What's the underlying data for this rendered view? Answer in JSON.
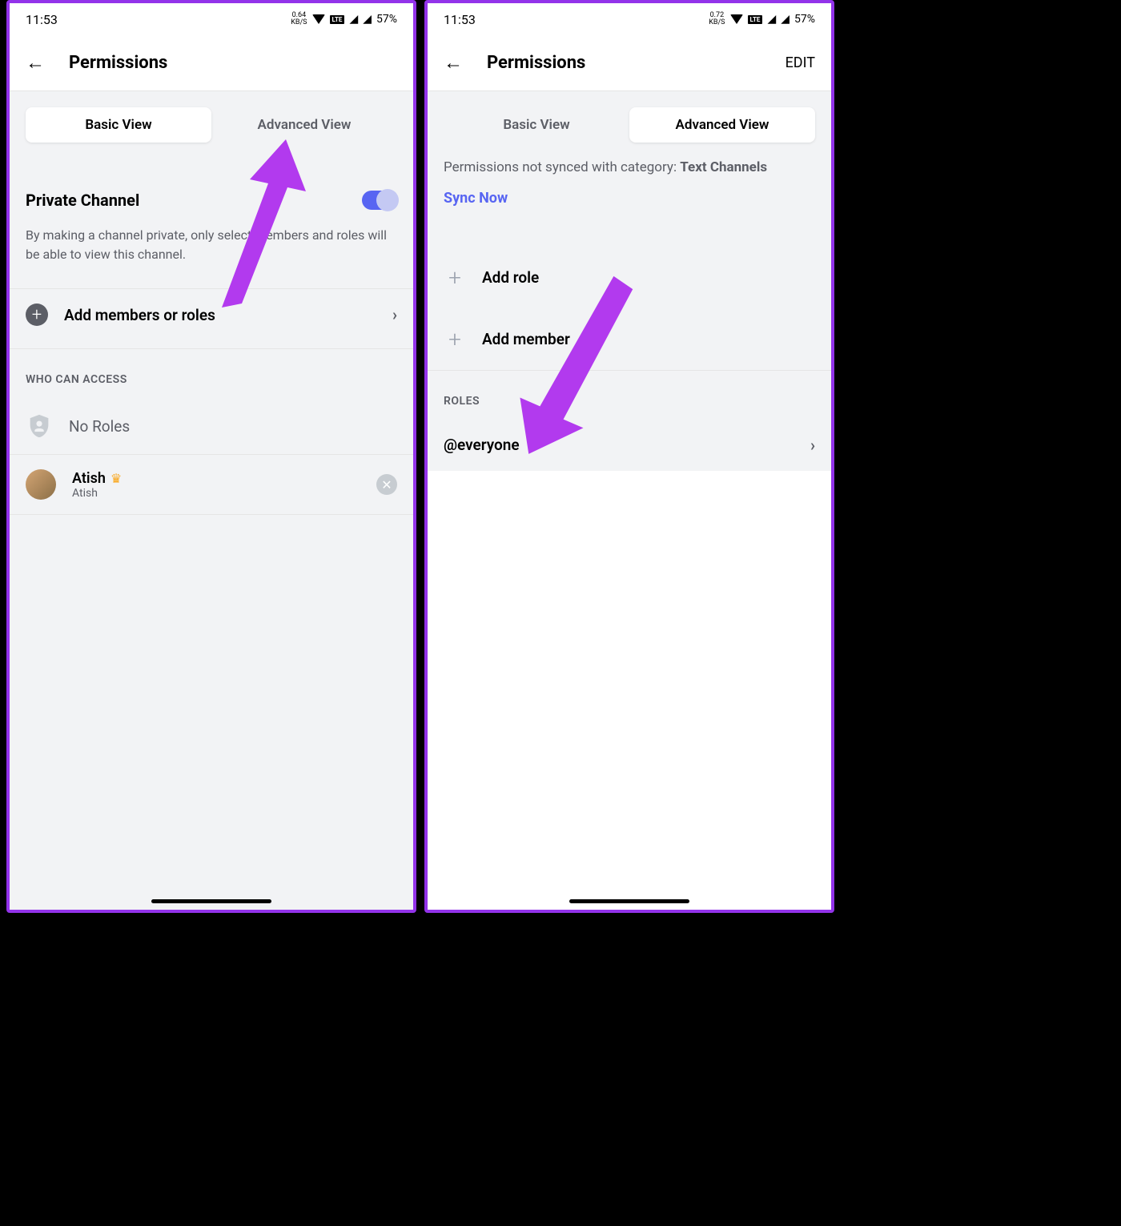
{
  "screen1": {
    "status": {
      "time": "11:53",
      "kb_value": "0.64",
      "kb_label": "KB/S",
      "lte": "Vo¹ LTE2",
      "battery": "57%"
    },
    "header": {
      "title": "Permissions"
    },
    "tabs": {
      "basic": "Basic View",
      "advanced": "Advanced View"
    },
    "private_channel": {
      "title": "Private Channel",
      "description": "By making a channel private, only select members and roles will be able to view this channel."
    },
    "add_members": "Add members or roles",
    "who_can_access": "WHO CAN ACCESS",
    "no_roles": "No Roles",
    "member": {
      "name": "Atish",
      "sub": "Atish"
    }
  },
  "screen2": {
    "status": {
      "time": "11:53",
      "kb_value": "0.72",
      "kb_label": "KB/S",
      "battery": "57%"
    },
    "header": {
      "title": "Permissions",
      "edit": "EDIT"
    },
    "tabs": {
      "basic": "Basic View",
      "advanced": "Advanced View"
    },
    "sync": {
      "prefix": "Permissions not synced with category: ",
      "category": "Text Channels",
      "button": "Sync Now"
    },
    "add_role": "Add role",
    "add_member": "Add member",
    "roles_header": "ROLES",
    "everyone": "@everyone"
  }
}
